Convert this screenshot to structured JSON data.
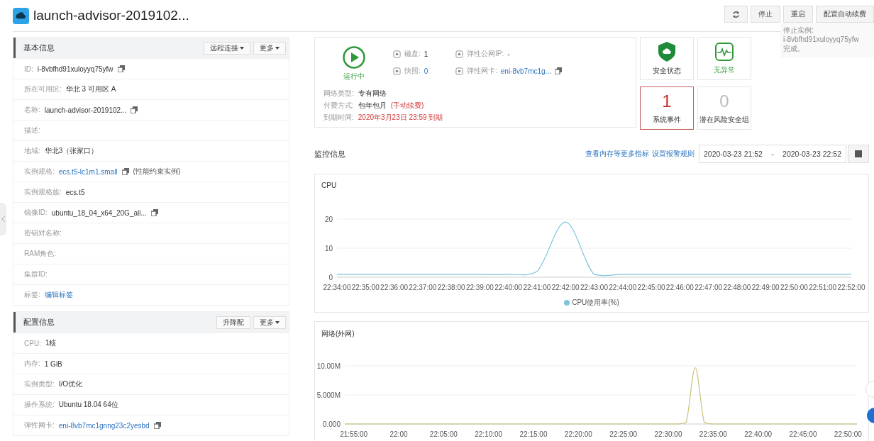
{
  "header": {
    "title": "launch-advisor-2019102...",
    "buttons": [
      "停止",
      "重启",
      "配置自动续费"
    ],
    "toast": [
      "停止实例:",
      "i-8vbfhd91xuloyyq75yfw",
      "完成。"
    ]
  },
  "sections": [
    {
      "title": "基本信息",
      "buttons": [
        {
          "label": "远程连接",
          "dropdown": true
        },
        {
          "label": "更多",
          "dropdown": true
        }
      ],
      "rows": [
        {
          "label": "ID:",
          "value": "i-8vbfhd91xuloyyq75yfw",
          "link": false,
          "copy": true
        },
        {
          "label": "所在可用区:",
          "value": "华北 3 可用区 A",
          "link": false,
          "copy": false
        },
        {
          "label": "名称:",
          "value": "launch-advisor-2019102...",
          "link": false,
          "copy": true
        },
        {
          "label": "描述:",
          "copy": false
        },
        {
          "label": "地域:",
          "value": "华北3（张家口）",
          "link": false,
          "copy": false
        },
        {
          "label": "实例规格:",
          "value": "ecs.t5-lc1m1.small",
          "link": true,
          "copy": true,
          "note": "(性能约束实例)"
        },
        {
          "label": "实例规格族:",
          "value": "ecs.t5",
          "link": false,
          "copy": false
        },
        {
          "label": "镜像ID:",
          "value": "ubuntu_18_04_x64_20G_ali...",
          "link": false,
          "copy": true
        },
        {
          "label": "密钥对名称:",
          "copy": false
        },
        {
          "label": "RAM角色:",
          "copy": false
        },
        {
          "label": "集群ID:",
          "copy": false
        },
        {
          "label": "标签:",
          "value": "编辑标签",
          "link": true,
          "copy": false
        }
      ]
    },
    {
      "title": "配置信息",
      "buttons": [
        {
          "label": "升降配",
          "dropdown": false
        },
        {
          "label": "更多",
          "dropdown": true
        }
      ],
      "rows": [
        {
          "label": "CPU:",
          "value": "1核",
          "link": false,
          "copy": false
        },
        {
          "label": "内存:",
          "value": "1 GiB",
          "link": false,
          "copy": false
        },
        {
          "label": "实例类型:",
          "value": "I/O优化",
          "link": false,
          "copy": false
        },
        {
          "label": "操作系统:",
          "value": "Ubuntu 18.04 64位",
          "link": false,
          "copy": false
        },
        {
          "label": "弹性网卡:",
          "value": "eni-8vb7mc1gnng23c2yesbd",
          "link": true,
          "copy": true
        }
      ]
    }
  ],
  "status_card": {
    "status": "运行中",
    "stats": [
      {
        "label": "磁盘:",
        "value": "1",
        "link": false,
        "copy": false
      },
      {
        "label": "弹性公网IP:",
        "value": "-",
        "link": false,
        "copy": false
      },
      {
        "label": "快照:",
        "value": "0",
        "link": true,
        "copy": false
      },
      {
        "label": "弹性网卡:",
        "value": "eni-8vb7mc1g...",
        "link": true,
        "copy": true
      }
    ],
    "details": [
      {
        "label": "网络类型:",
        "value": "专有网络",
        "warning": false
      },
      {
        "label": "付费方式:",
        "value": "包年包月",
        "note": "(手动续费)",
        "warning": false
      },
      {
        "label": "到期时间:",
        "value": "2020年3月23日 23:59 到期",
        "warning": true
      }
    ]
  },
  "tiles": [
    {
      "kind": "shield",
      "label": "安全状态",
      "alert": false
    },
    {
      "kind": "pulse",
      "label": "无异常",
      "alert": false
    },
    {
      "kind": "count",
      "value": "1",
      "label": "系统事件",
      "alert": true
    },
    {
      "kind": "count",
      "value": "0",
      "label": "潜在风险安全组",
      "alert": false
    }
  ],
  "monitor": {
    "title": "监控信息",
    "links": [
      "查看内存等更多指标",
      "设置报警规则"
    ],
    "date_range": {
      "start": "2020-03-23 21:52",
      "separator": "-",
      "end": "2020-03-23 22:52"
    },
    "charts": [
      {
        "title": "CPU",
        "chart_data": {
          "type": "line",
          "categories": [
            "22:34:00",
            "22:35:00",
            "22:36:00",
            "22:37:00",
            "22:38:00",
            "22:39:00",
            "22:40:00",
            "22:41:00",
            "22:42:00",
            "22:43:00",
            "22:44:00",
            "22:45:00",
            "22:46:00",
            "22:47:00",
            "22:48:00",
            "22:49:00",
            "22:50:00",
            "22:51:00",
            "22:52:00"
          ],
          "ylim": [
            0,
            20
          ],
          "yticks": [
            0,
            10,
            20
          ],
          "series": [
            {
              "name": "CPU使用率(%)",
              "color": "#7ec4dc",
              "values": [
                1,
                1,
                1,
                1,
                1,
                1,
                1,
                2,
                19,
                1,
                1,
                1,
                1,
                1,
                1,
                1,
                1,
                1,
                1
              ]
            }
          ]
        }
      },
      {
        "title": "网络(外网)",
        "chart_data": {
          "type": "line",
          "categories": [
            null,
            "21:55:00",
            null,
            null,
            null,
            null,
            "22:00",
            null,
            null,
            null,
            null,
            "22:05:00",
            null,
            null,
            null,
            null,
            "22:10:00",
            null,
            null,
            null,
            null,
            "22:15:00",
            null,
            null,
            null,
            null,
            "22:20:00",
            null,
            null,
            null,
            null,
            "22:25:00",
            null,
            null,
            null,
            null,
            "22:30:00",
            null,
            null,
            null,
            null,
            "22:35:00",
            null,
            null,
            null,
            null,
            "22:40:00",
            null,
            null,
            null,
            null,
            "22:45:00",
            null,
            null,
            null,
            null,
            "22:50:00",
            null
          ],
          "ylim": [
            0,
            10
          ],
          "yticks": [
            {
              "value": 0,
              "label": "0.000"
            },
            {
              "value": 5,
              "label": "5.000M"
            },
            {
              "value": 10,
              "label": "10.00M"
            }
          ],
          "series": [
            {
              "color": "#c8c27c",
              "values": [
                0,
                0,
                0,
                0,
                0,
                0,
                0,
                0,
                0,
                0,
                0,
                0,
                0,
                0,
                0,
                0,
                0,
                0,
                0,
                0,
                0,
                0,
                0,
                0,
                0,
                0,
                0,
                0,
                0,
                0,
                0,
                0,
                0,
                0,
                0,
                0,
                0,
                0,
                0.3,
                9.7,
                0.3,
                0,
                0,
                0,
                0,
                0,
                0,
                0,
                0,
                0,
                0,
                0,
                0,
                0,
                0,
                0,
                0,
                0
              ]
            }
          ]
        }
      }
    ]
  }
}
